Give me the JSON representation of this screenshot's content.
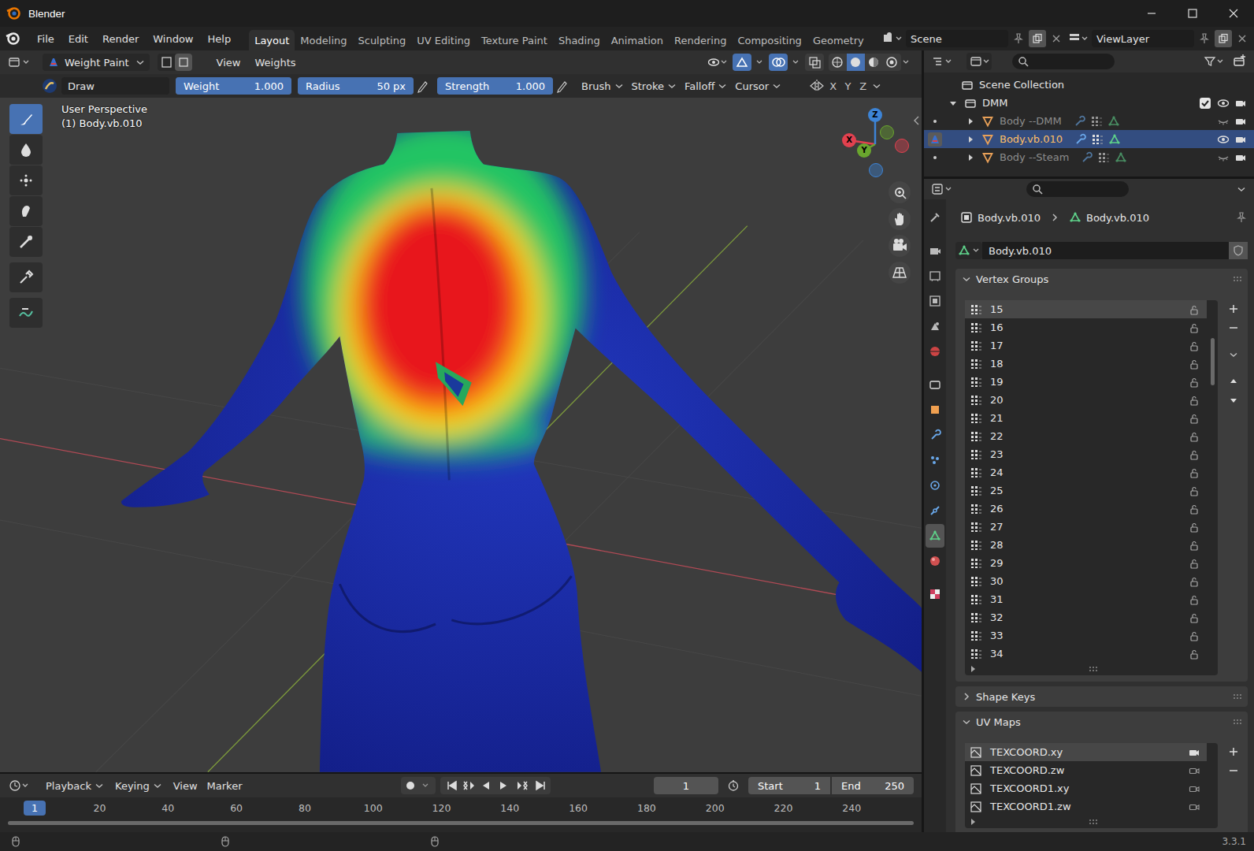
{
  "window": {
    "title": "Blender"
  },
  "menu": [
    "File",
    "Edit",
    "Render",
    "Window",
    "Help"
  ],
  "workspaces": [
    {
      "label": "Layout",
      "selected": true
    },
    {
      "label": "Modeling",
      "selected": false
    },
    {
      "label": "Sculpting",
      "selected": false
    },
    {
      "label": "UV Editing",
      "selected": false
    },
    {
      "label": "Texture Paint",
      "selected": false
    },
    {
      "label": "Shading",
      "selected": false
    },
    {
      "label": "Animation",
      "selected": false
    },
    {
      "label": "Rendering",
      "selected": false
    },
    {
      "label": "Compositing",
      "selected": false
    },
    {
      "label": "Geometry",
      "selected": false
    }
  ],
  "scene": "Scene",
  "view_layer": "ViewLayer",
  "viewport_header": {
    "mode": "Weight Paint",
    "menus": [
      "View",
      "Weights"
    ]
  },
  "tool_settings": {
    "brush": "Draw",
    "sliders": [
      {
        "label": "Weight",
        "value": "1.000",
        "level": 1
      },
      {
        "label": "Radius",
        "value": "50 px",
        "level": 1
      },
      {
        "label": "Strength",
        "value": "1.000",
        "level": 1
      }
    ],
    "menus": [
      "Brush",
      "Stroke",
      "Falloff",
      "Cursor"
    ],
    "mirror_axes": [
      {
        "label": "X",
        "on": false
      },
      {
        "label": "Y",
        "on": false
      },
      {
        "label": "Z",
        "on": false
      }
    ]
  },
  "tools": [
    {
      "selected": true
    },
    {
      "selected": false
    },
    {
      "selected": false
    },
    {
      "selected": false
    },
    {
      "selected": false
    },
    {
      "selected": false
    },
    {
      "selected": false
    }
  ],
  "viewport": {
    "view": "User Perspective",
    "object": "(1) Body.vb.010",
    "gizmo": [
      {
        "label": "X",
        "color": "#e2414f"
      },
      {
        "label": "Y",
        "color": "#6aa62e"
      },
      {
        "label": "Z",
        "color": "#3d84d6"
      }
    ]
  },
  "outliner": {
    "items": [
      {
        "label": "Scene Collection",
        "depth": 0,
        "kind": "root",
        "expanded": true,
        "checked": false,
        "selected": false,
        "hidden": false
      },
      {
        "label": "DMM",
        "depth": 1,
        "kind": "collection",
        "expanded": true,
        "checked": true,
        "selected": false,
        "hidden": false
      },
      {
        "label": "Body --DMM",
        "depth": 2,
        "kind": "mesh",
        "expanded": false,
        "checked": false,
        "selected": false,
        "hidden": true
      },
      {
        "label": "Body.vb.010",
        "depth": 2,
        "kind": "mesh",
        "expanded": false,
        "checked": false,
        "selected": true,
        "hidden": false
      },
      {
        "label": "Body --Steam",
        "depth": 2,
        "kind": "mesh",
        "expanded": false,
        "checked": false,
        "selected": false,
        "hidden": true
      }
    ]
  },
  "properties": {
    "tabs": [
      {
        "selected": false
      },
      {
        "selected": false
      },
      {
        "selected": false
      },
      {
        "selected": false
      },
      {
        "selected": false
      },
      {
        "selected": false
      },
      {
        "selected": false
      },
      {
        "selected": false
      },
      {
        "selected": false
      },
      {
        "selected": false
      },
      {
        "selected": false
      },
      {
        "selected": false
      },
      {
        "selected": true
      },
      {
        "selected": false
      },
      {
        "selected": false
      }
    ],
    "breadcrumb": [
      "Body.vb.010",
      "Body.vb.010"
    ],
    "data_name": "Body.vb.010",
    "vertex_groups": {
      "title": "Vertex Groups",
      "expanded": true,
      "items": [
        {
          "label": "15",
          "selected": true
        },
        {
          "label": "16",
          "selected": false
        },
        {
          "label": "17",
          "selected": false
        },
        {
          "label": "18",
          "selected": false
        },
        {
          "label": "19",
          "selected": false
        },
        {
          "label": "20",
          "selected": false
        },
        {
          "label": "21",
          "selected": false
        },
        {
          "label": "22",
          "selected": false
        },
        {
          "label": "23",
          "selected": false
        },
        {
          "label": "24",
          "selected": false
        },
        {
          "label": "25",
          "selected": false
        },
        {
          "label": "26",
          "selected": false
        },
        {
          "label": "27",
          "selected": false
        },
        {
          "label": "28",
          "selected": false
        },
        {
          "label": "29",
          "selected": false
        },
        {
          "label": "30",
          "selected": false
        },
        {
          "label": "31",
          "selected": false
        },
        {
          "label": "32",
          "selected": false
        },
        {
          "label": "33",
          "selected": false
        },
        {
          "label": "34",
          "selected": false
        }
      ]
    },
    "shape_keys": {
      "title": "Shape Keys",
      "expanded": false
    },
    "uv_maps": {
      "title": "UV Maps",
      "expanded": true,
      "items": [
        {
          "label": "TEXCOORD.xy",
          "selected": true,
          "active_render": true
        },
        {
          "label": "TEXCOORD.zw",
          "selected": false,
          "active_render": false
        },
        {
          "label": "TEXCOORD1.xy",
          "selected": false,
          "active_render": false
        },
        {
          "label": "TEXCOORD1.zw",
          "selected": false,
          "active_render": false
        }
      ]
    }
  },
  "timeline": {
    "menus": [
      {
        "label": "Playback",
        "kind": "dropdown"
      },
      {
        "label": "Keying",
        "kind": "dropdown"
      },
      {
        "label": "View",
        "kind": "plain"
      },
      {
        "label": "Marker",
        "kind": "plain"
      }
    ],
    "current_frame": "1",
    "start": {
      "label": "Start",
      "value": "1"
    },
    "end": {
      "label": "End",
      "value": "250"
    },
    "ruler": [
      {
        "label": "1",
        "selected": true
      },
      {
        "label": "20",
        "selected": false
      },
      {
        "label": "40",
        "selected": false
      },
      {
        "label": "60",
        "selected": false
      },
      {
        "label": "80",
        "selected": false
      },
      {
        "label": "100",
        "selected": false
      },
      {
        "label": "120",
        "selected": false
      },
      {
        "label": "140",
        "selected": false
      },
      {
        "label": "160",
        "selected": false
      },
      {
        "label": "180",
        "selected": false
      },
      {
        "label": "200",
        "selected": false
      },
      {
        "label": "220",
        "selected": false
      },
      {
        "label": "240",
        "selected": false
      }
    ]
  },
  "status": {
    "version": "3.3.1"
  }
}
